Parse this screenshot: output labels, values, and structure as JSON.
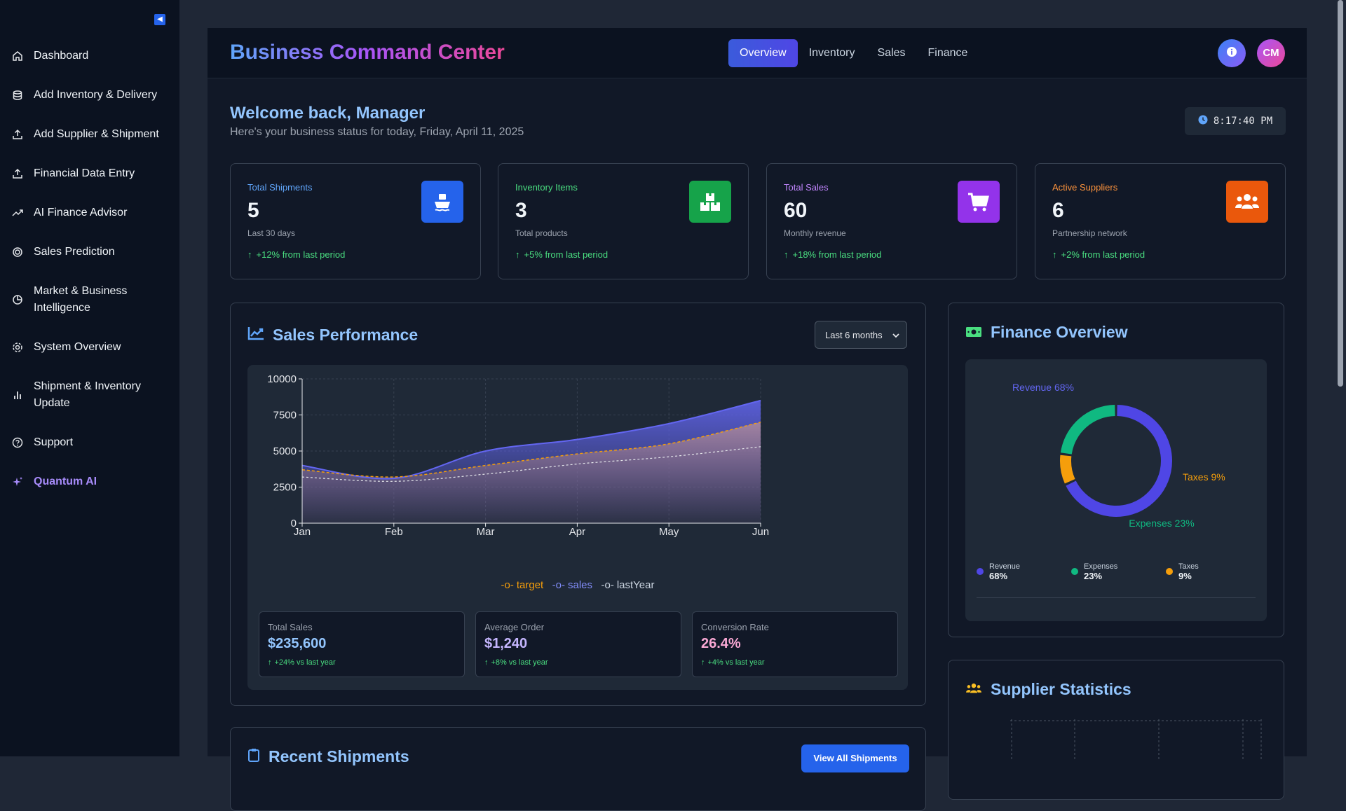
{
  "sidebar": {
    "items": [
      {
        "label": "Dashboard",
        "icon": "home-icon"
      },
      {
        "label": "Add Inventory & Delivery",
        "icon": "database-icon"
      },
      {
        "label": "Add Supplier & Shipment",
        "icon": "upload-icon"
      },
      {
        "label": "Financial Data Entry",
        "icon": "upload-icon"
      },
      {
        "label": "AI Finance Advisor",
        "icon": "trend-icon"
      },
      {
        "label": "Sales Prediction",
        "icon": "target-icon"
      },
      {
        "label": "Market & Business Intelligence",
        "icon": "pie-icon"
      },
      {
        "label": "System Overview",
        "icon": "gear-icon"
      },
      {
        "label": "Shipment & Inventory Update",
        "icon": "bar-icon"
      },
      {
        "label": "Support",
        "icon": "help-icon"
      },
      {
        "label": "Quantum AI",
        "icon": "sparkle-icon"
      }
    ]
  },
  "header": {
    "title": "Business Command Center",
    "tabs": [
      "Overview",
      "Inventory",
      "Sales",
      "Finance"
    ],
    "active_tab": "Overview",
    "avatar_initials": "CM"
  },
  "welcome": {
    "title": "Welcome back, Manager",
    "subtitle": "Here's your business status for today, Friday, April 11, 2025",
    "time": "8:17:40 PM"
  },
  "stats": [
    {
      "label": "Total Shipments",
      "value": "5",
      "sub": "Last 30 days",
      "change": "+12% from last period",
      "color": "#60a5fa",
      "icon": "ship-icon",
      "icon_bg": "#2563eb"
    },
    {
      "label": "Inventory Items",
      "value": "3",
      "sub": "Total products",
      "change": "+5% from last period",
      "color": "#4ade80",
      "icon": "boxes-icon",
      "icon_bg": "#16a34a"
    },
    {
      "label": "Total Sales",
      "value": "60",
      "sub": "Monthly revenue",
      "change": "+18% from last period",
      "color": "#c084fc",
      "icon": "cart-icon",
      "icon_bg": "#9333ea"
    },
    {
      "label": "Active Suppliers",
      "value": "6",
      "sub": "Partnership network",
      "change": "+2% from last period",
      "color": "#fb923c",
      "icon": "users-icon",
      "icon_bg": "#ea580c"
    }
  ],
  "sales_panel": {
    "title": "Sales Performance",
    "range": "Last 6 months",
    "metrics": [
      {
        "label": "Total Sales",
        "value": "$235,600",
        "change": "+24% vs last year",
        "color": "#93c5fd"
      },
      {
        "label": "Average Order",
        "value": "$1,240",
        "change": "+8% vs last year",
        "color": "#c4b5fd"
      },
      {
        "label": "Conversion Rate",
        "value": "26.4%",
        "change": "+4% vs last year",
        "color": "#f9a8d4"
      }
    ],
    "next_section_title": "Recent Shipments",
    "next_section_button": "View All Shipments"
  },
  "chart_data": {
    "type": "area",
    "categories": [
      "Jan",
      "Feb",
      "Mar",
      "Apr",
      "May",
      "Jun"
    ],
    "ylim": [
      0,
      10000
    ],
    "yticks": [
      0,
      2500,
      5000,
      7500,
      10000
    ],
    "series": [
      {
        "name": "target",
        "values": [
          3700,
          3200,
          4000,
          4800,
          5500,
          7000
        ],
        "color": "#f59e0b"
      },
      {
        "name": "sales",
        "values": [
          4000,
          3100,
          5000,
          5800,
          6900,
          8500
        ],
        "color": "#6366f1"
      },
      {
        "name": "lastYear",
        "values": [
          3200,
          2900,
          3400,
          4100,
          4600,
          5300
        ],
        "color": "#cbd5e1"
      }
    ]
  },
  "finance": {
    "title": "Finance Overview",
    "slices": [
      {
        "name": "Revenue",
        "value": 68,
        "label": "Revenue 68%",
        "pct": "68%",
        "color": "#4f46e5"
      },
      {
        "name": "Taxes",
        "value": 9,
        "label": "Taxes 9%",
        "pct": "9%",
        "color": "#f59e0b"
      },
      {
        "name": "Expenses",
        "value": 23,
        "label": "Expenses 23%",
        "pct": "23%",
        "color": "#10b981"
      }
    ]
  },
  "supplier": {
    "title": "Supplier Statistics"
  }
}
